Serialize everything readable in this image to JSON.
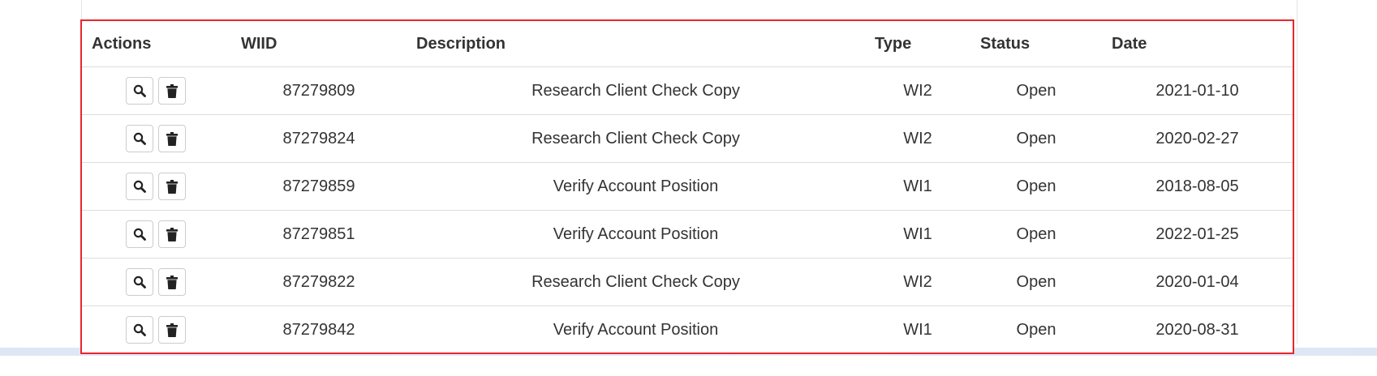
{
  "table": {
    "headers": {
      "actions": "Actions",
      "wiid": "WIID",
      "description": "Description",
      "type": "Type",
      "status": "Status",
      "date": "Date"
    },
    "rows": [
      {
        "wiid": "87279809",
        "description": "Research Client Check Copy",
        "type": "WI2",
        "status": "Open",
        "date": "2021-01-10"
      },
      {
        "wiid": "87279824",
        "description": "Research Client Check Copy",
        "type": "WI2",
        "status": "Open",
        "date": "2020-02-27"
      },
      {
        "wiid": "87279859",
        "description": "Verify Account Position",
        "type": "WI1",
        "status": "Open",
        "date": "2018-08-05"
      },
      {
        "wiid": "87279851",
        "description": "Verify Account Position",
        "type": "WI1",
        "status": "Open",
        "date": "2022-01-25"
      },
      {
        "wiid": "87279822",
        "description": "Research Client Check Copy",
        "type": "WI2",
        "status": "Open",
        "date": "2020-01-04"
      },
      {
        "wiid": "87279842",
        "description": "Verify Account Position",
        "type": "WI1",
        "status": "Open",
        "date": "2020-08-31"
      }
    ],
    "row_actions": [
      "search-icon",
      "trash-icon"
    ]
  },
  "colors": {
    "highlight_border": "#e8262e",
    "row_divider": "#dddddd",
    "text": "#333333"
  }
}
